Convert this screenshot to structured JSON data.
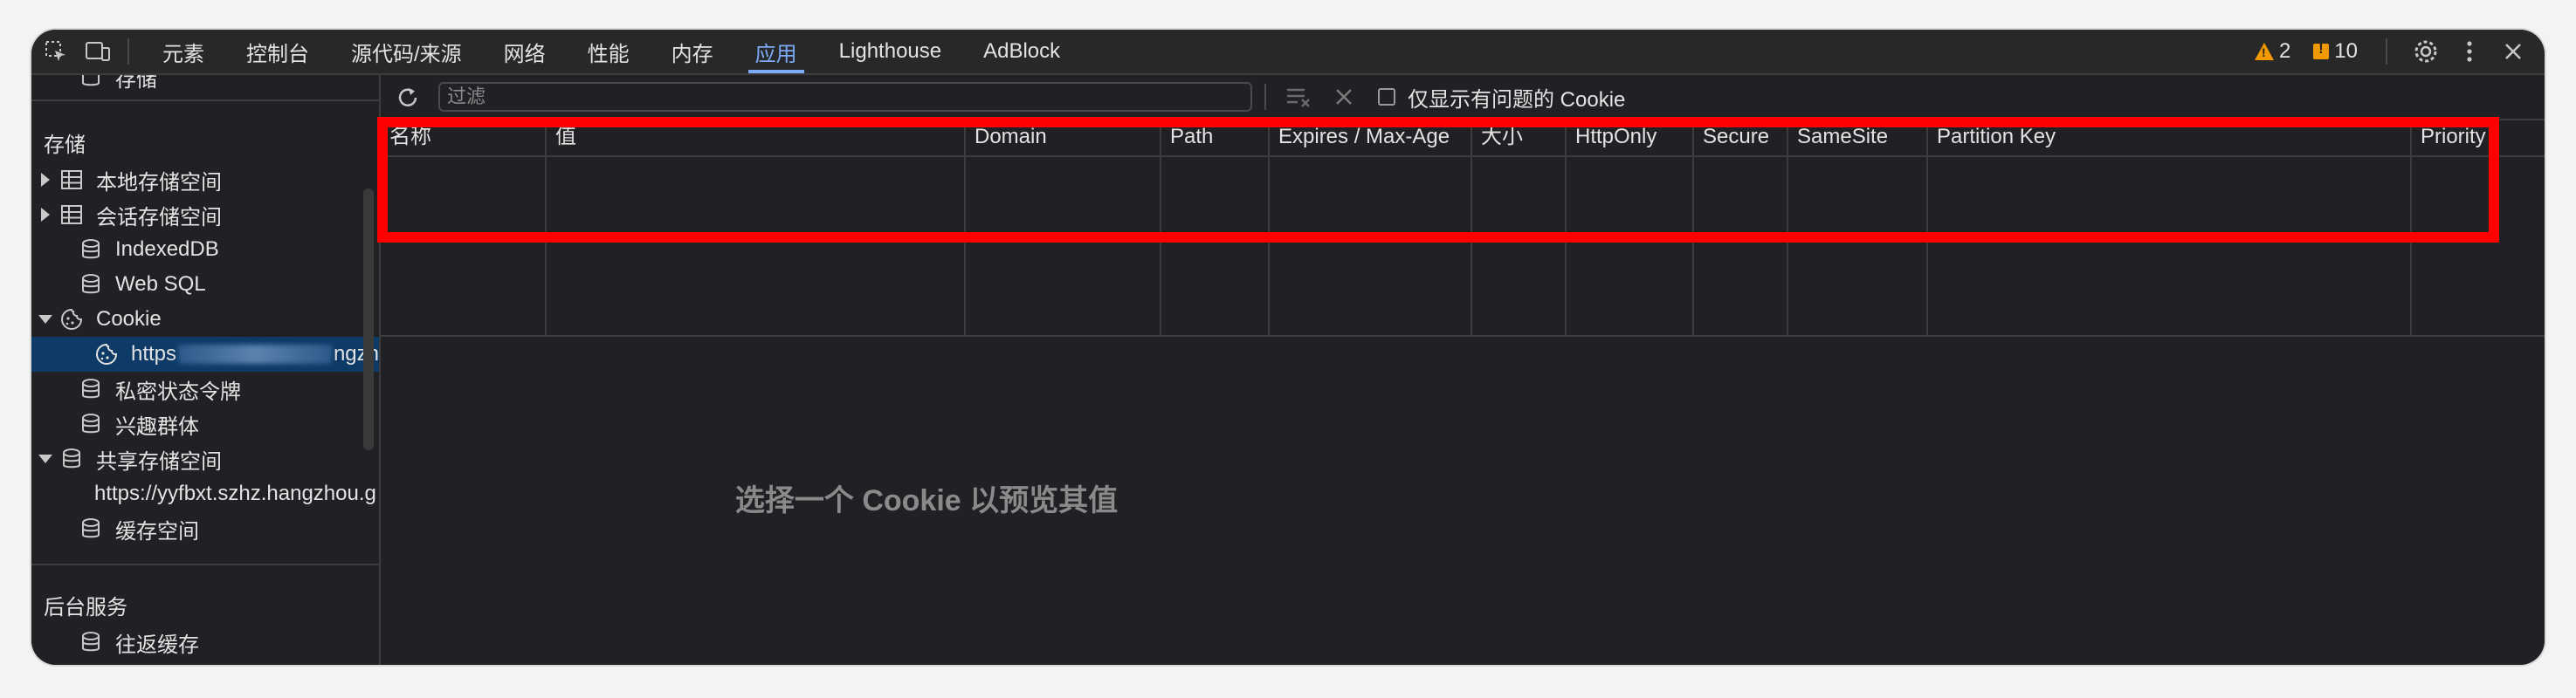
{
  "tabs": [
    {
      "label": "元素"
    },
    {
      "label": "控制台"
    },
    {
      "label": "源代码/来源"
    },
    {
      "label": "网络"
    },
    {
      "label": "性能"
    },
    {
      "label": "内存"
    },
    {
      "label": "应用",
      "active": true
    },
    {
      "label": "Lighthouse"
    },
    {
      "label": "AdBlock"
    }
  ],
  "status": {
    "warnings": "2",
    "issues": "10"
  },
  "sidebar": {
    "partial_top": "存储",
    "storage_header": "存储",
    "items": [
      {
        "label": "本地存储空间"
      },
      {
        "label": "会话存储空间"
      },
      {
        "label": "IndexedDB"
      },
      {
        "label": "Web SQL"
      },
      {
        "label": "Cookie"
      },
      {
        "label_start": "https",
        "label_end": "ngzh"
      },
      {
        "label": "私密状态令牌"
      },
      {
        "label": "兴趣群体"
      },
      {
        "label": "共享存储空间"
      },
      {
        "label": "https://yyfbxt.szhz.hangzhou.g"
      },
      {
        "label": "缓存空间"
      }
    ],
    "background_header": "后台服务",
    "bg_items": [
      {
        "label": "往返缓存"
      }
    ]
  },
  "toolbar": {
    "filter_placeholder": "过滤",
    "only_issues_label": "仅显示有问题的 Cookie"
  },
  "columns": [
    "名称",
    "值",
    "Domain",
    "Path",
    "Expires / Max-Age",
    "大小",
    "HttpOnly",
    "Secure",
    "SameSite",
    "Partition Key",
    "Priority"
  ],
  "empty_message": "选择一个 Cookie 以预览其值",
  "colors": {
    "accent": "#7cacf8",
    "highlight": "#ff0000",
    "warning": "#f29900",
    "selected_row": "#0d3a66"
  }
}
